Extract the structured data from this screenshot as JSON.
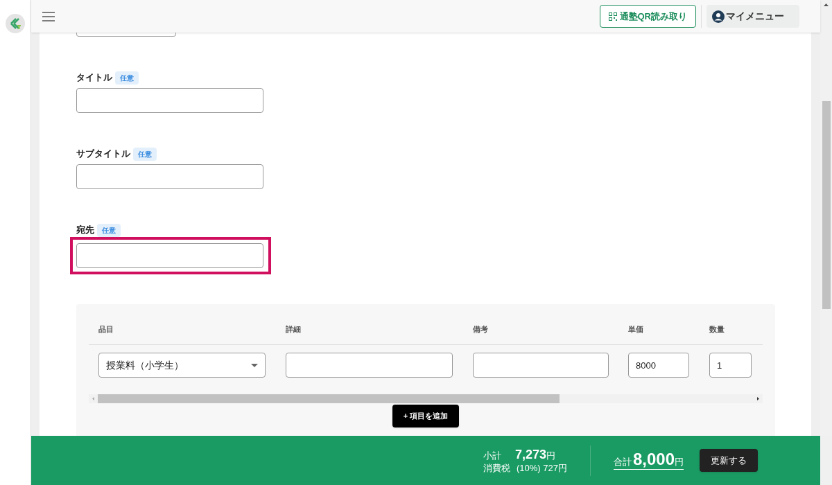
{
  "header": {
    "qr_button": "通塾QR読み取り",
    "menu_button": "マイメニュー"
  },
  "fields": [
    {
      "highlighted": false,
      "kind": "partial"
    },
    {
      "label": "タイトル",
      "badge": "任意",
      "highlighted": false,
      "kind": "text"
    },
    {
      "label": "サブタイトル",
      "badge": "任意",
      "highlighted": false,
      "kind": "text"
    },
    {
      "label": "宛先",
      "badge": "任意",
      "highlighted": true,
      "kind": "text"
    }
  ],
  "items": {
    "columns": [
      "品目",
      "詳細",
      "備考",
      "単価",
      "数量"
    ],
    "rows": [
      {
        "item": "授業料（小学生）",
        "unit_price": "8000",
        "quantity": "1"
      }
    ],
    "add_button": "+ 項目を追加"
  },
  "footer": {
    "subtotal_label": "小計",
    "subtotal_value": "7,273",
    "subtotal_unit": "円",
    "tax_label": "消費税",
    "tax_value": "(10%) 727円",
    "total_label": "合計",
    "total_value": "8,000",
    "total_unit": "円",
    "update_button": "更新する"
  }
}
